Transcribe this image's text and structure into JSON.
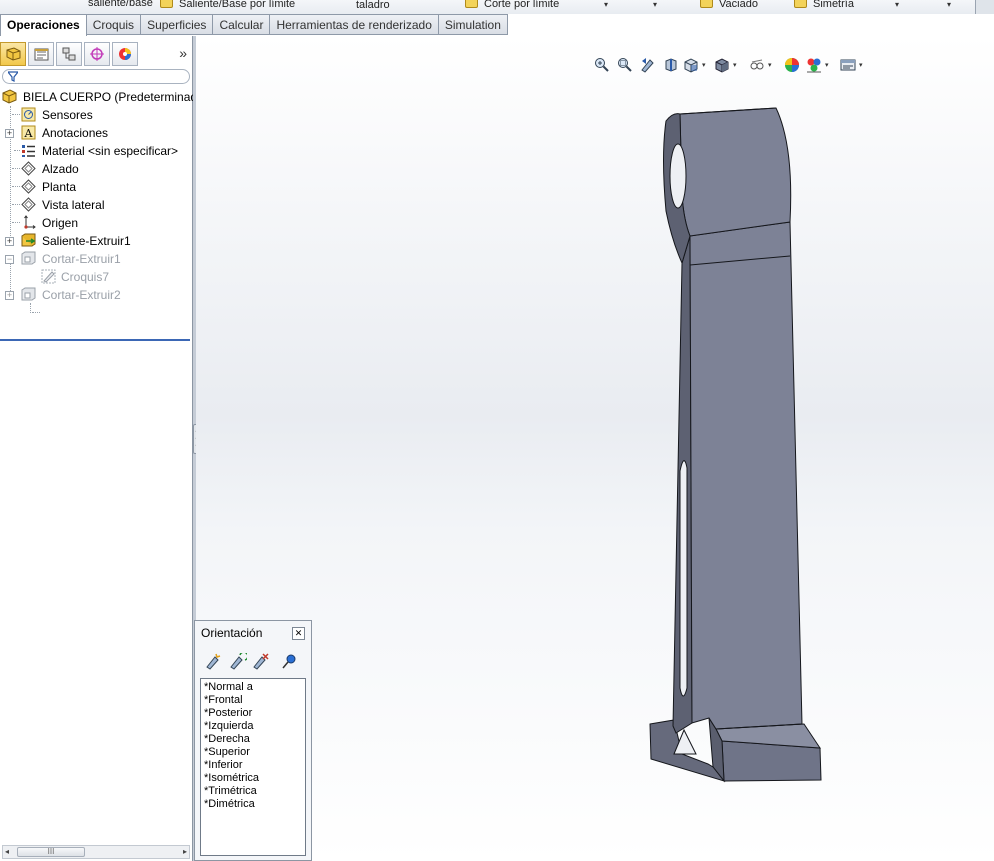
{
  "ribbon": {
    "items": [
      "saliente/base",
      "Saliente/Base por límite",
      "taladro",
      "Corte por límite",
      "Vaciado",
      "Simetría"
    ]
  },
  "tabs": [
    {
      "label": "Operaciones",
      "active": true
    },
    {
      "label": "Croquis",
      "active": false
    },
    {
      "label": "Superficies",
      "active": false
    },
    {
      "label": "Calcular",
      "active": false
    },
    {
      "label": "Herramientas de renderizado",
      "active": false
    },
    {
      "label": "Simulation",
      "active": false
    }
  ],
  "panel": {
    "more_glyph": "»",
    "tabs_icons": [
      "featuremanager-icon",
      "propertymanager-icon",
      "configurationmanager-icon",
      "dimxpert-icon",
      "display-manager-icon"
    ]
  },
  "tree": {
    "root": "BIELA CUERPO  (Predeterminad",
    "items": [
      {
        "label": "Sensores",
        "icon": "sensors-icon"
      },
      {
        "label": "Anotaciones",
        "icon": "annotations-icon"
      },
      {
        "label": "Material <sin especificar>",
        "icon": "material-icon"
      },
      {
        "label": "Alzado",
        "icon": "plane-icon"
      },
      {
        "label": "Planta",
        "icon": "plane-icon"
      },
      {
        "label": "Vista lateral",
        "icon": "plane-icon"
      },
      {
        "label": "Origen",
        "icon": "origin-icon"
      },
      {
        "label": "Saliente-Extruir1",
        "icon": "boss-extrude-icon"
      },
      {
        "label": "Cortar-Extruir1",
        "icon": "cut-extrude-icon",
        "suppressed": true
      },
      {
        "label": "Croquis7",
        "icon": "sketch-icon",
        "suppressed": true
      },
      {
        "label": "Cortar-Extruir2",
        "icon": "cut-extrude-icon",
        "suppressed": true
      }
    ]
  },
  "scrollbar": {
    "thumb_glyph": "III"
  },
  "orientation": {
    "title": "Orientación",
    "close_glyph": "✕",
    "views": [
      "*Normal a",
      "*Frontal",
      "*Posterior",
      "*Izquierda",
      "*Derecha",
      "*Superior",
      "*Inferior",
      "*Isométrica",
      "*Trimétrica",
      "*Dimétrica"
    ]
  },
  "colors": {
    "model_face": "#7d8296",
    "model_side": "#5d6172",
    "model_edge": "#1a1c22",
    "rollback_bar": "#3b67b5"
  }
}
